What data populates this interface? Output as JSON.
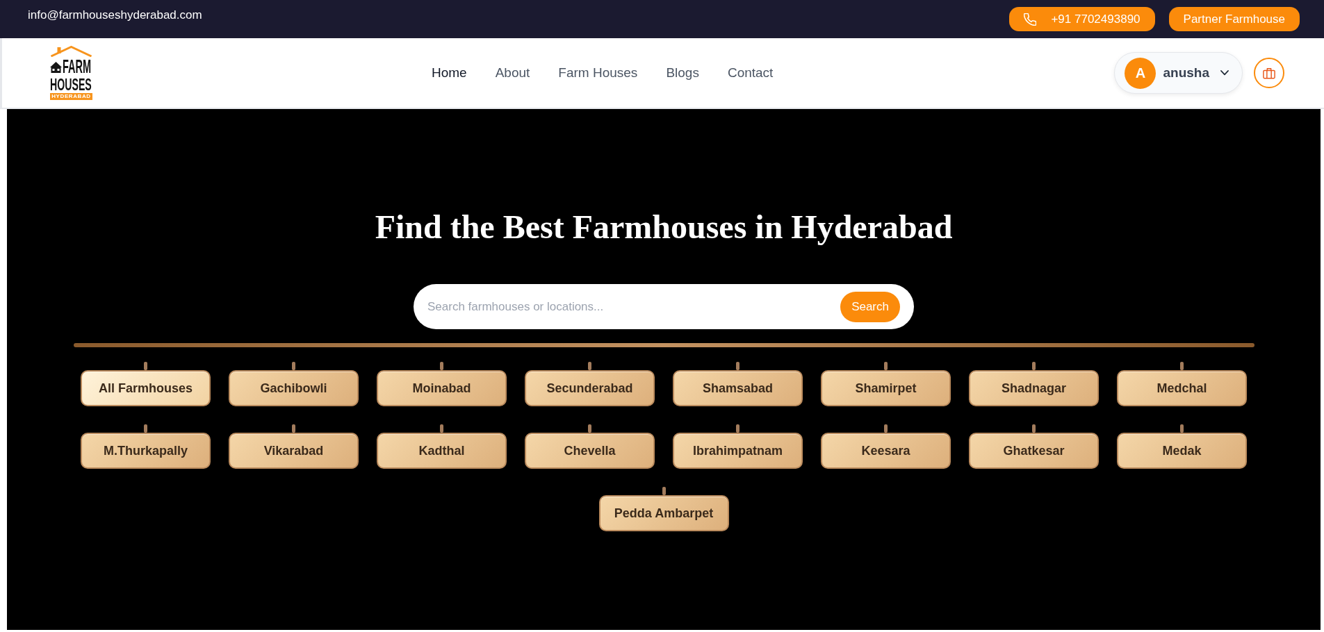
{
  "top_bar": {
    "email": "info@farmhouseshyderabad.com",
    "buttons": [
      {
        "kind": "call",
        "label": "+91 7702493890"
      },
      {
        "kind": "partner",
        "label": "Partner Farmhouse"
      }
    ]
  },
  "header": {
    "logo": {
      "wordmark": [
        "FARM",
        "HOUSES"
      ],
      "tagline": "HYDERABAD"
    },
    "nav": [
      {
        "label": "Home",
        "selected": true
      },
      {
        "label": "About",
        "selected": false
      },
      {
        "label": "Farm Houses",
        "selected": false
      },
      {
        "label": "Blogs",
        "selected": false
      },
      {
        "label": "Contact",
        "selected": false
      }
    ],
    "user_menu": {
      "initial": "A",
      "name": "anusha"
    }
  },
  "hero": {
    "title": "Find the Best Farmhouses in Hyderabad",
    "search": {
      "placeholder": "Search farmhouses or locations...",
      "button": "Search"
    },
    "locations": [
      {
        "label": "All Farmhouses",
        "selected": true
      },
      {
        "label": "Gachibowli",
        "selected": false
      },
      {
        "label": "Moinabad",
        "selected": false
      },
      {
        "label": "Secunderabad",
        "selected": false
      },
      {
        "label": "Shamsabad",
        "selected": false
      },
      {
        "label": "Shamirpet",
        "selected": false
      },
      {
        "label": "Shadnagar",
        "selected": false
      },
      {
        "label": "Medchal",
        "selected": false
      },
      {
        "label": "M.Thurkapally",
        "selected": false
      },
      {
        "label": "Vikarabad",
        "selected": false
      },
      {
        "label": "Kadthal",
        "selected": false
      },
      {
        "label": "Chevella",
        "selected": false
      },
      {
        "label": "Ibrahimpatnam",
        "selected": false
      },
      {
        "label": "Keesara",
        "selected": false
      },
      {
        "label": "Ghatkesar",
        "selected": false
      },
      {
        "label": "Medak",
        "selected": false
      },
      {
        "label": "Pedda Ambarpet",
        "selected": false
      }
    ]
  }
}
